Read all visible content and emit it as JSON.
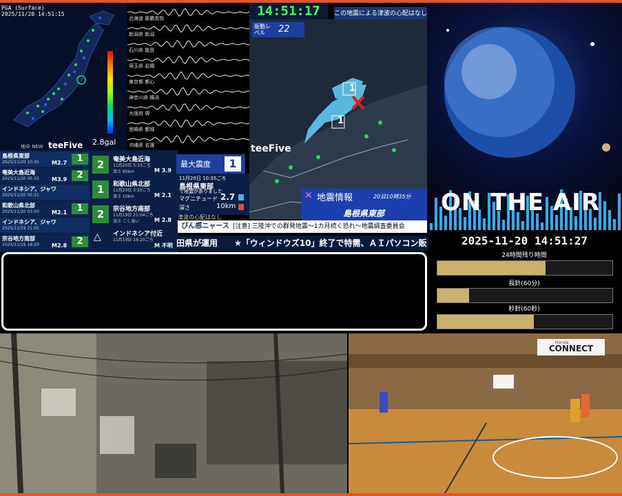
{
  "pga_panel": {
    "title_line1": "PGA (Surface)",
    "title_line2": "2025/11/20 14:51:15",
    "max_label": "2.8gal",
    "note": "地中 NEW",
    "brand": "teeFive"
  },
  "waveform": {
    "stations": [
      "北海道 那覇長牧",
      "新潟県 新潟",
      "石川県 能登",
      "埼玉県 岩槻",
      "東京都 都心",
      "神奈川県 横浜",
      "大阪府 堺",
      "宮崎県 都城",
      "沖縄県 名護"
    ]
  },
  "quake_list": [
    {
      "region": "島根県東部",
      "time": "2025/11/20 10:35",
      "mag": "M2.7",
      "intensity": "1"
    },
    {
      "region": "奄美大島近海",
      "time": "2025/11/20 05:33",
      "mag": "M3.9",
      "intensity": "2"
    },
    {
      "region": "インドネシア、ジャワ",
      "time": "2025/11/20 05:31",
      "mag": "",
      "intensity": ""
    },
    {
      "region": "和歌山県北部",
      "time": "2025/11/20 03:50",
      "mag": "M2.1",
      "intensity": "1"
    },
    {
      "region": "インドネシア、ジャワ",
      "time": "2025/11/19 21:05",
      "mag": "",
      "intensity": ""
    },
    {
      "region": "宗谷地方南部",
      "time": "2025/11/19 18:20",
      "mag": "M2.8",
      "intensity": "2"
    }
  ],
  "quake_detail": [
    {
      "region": "奄美大島近海",
      "date": "11月20日 5:33ごろ",
      "depth": "深さ 60km",
      "mag": "M 3.9",
      "intensity": "2"
    },
    {
      "region": "和歌山県北部",
      "date": "11月20日 3:50ごろ",
      "depth": "深さ 10km",
      "mag": "M 2.1",
      "intensity": "1"
    },
    {
      "region": "宗谷地方南部",
      "date": "11月19日 21:04ごろ",
      "depth": "深さ ごく浅い",
      "mag": "M 2.8",
      "intensity": "2"
    },
    {
      "region": "インドネシア付近",
      "date": "11月19日 18:20ごろ",
      "depth": "",
      "mag": "M 不明",
      "intensity": ""
    }
  ],
  "intensity_label": "最大震度",
  "max_intensity": {
    "label": "最大震度",
    "value": "1"
  },
  "epicenter": {
    "date": "11月20日 10:35ごろ",
    "region": "島根県東部",
    "note": "で地震がありました",
    "magnitude_label": "マグニチュード",
    "magnitude": "2.7",
    "depth_label": "深さ",
    "depth": "10km",
    "tsunami_note": "津波の心配はなし"
  },
  "map": {
    "clock": "14:51:17",
    "tsunami_banner": "この地震による津波の心配はなし",
    "level_label": "振動レベル",
    "level_value": "22",
    "info_title": "地震情報",
    "info_time": "20日10時35分",
    "info_region": "島根県東部",
    "brand": "teeFive"
  },
  "tickers": {
    "label": "びん感ニャース",
    "line1": "[注意] 三陸沖での群発地震〜1カ月続く恐れ〜地震調査委員会",
    "line2": "田県が運用　　★「ウィンドウズ10」終了で特需、ＡＩパソコン販"
  },
  "space": {
    "onair": "ON THE AIR",
    "datetime": "2025-11-20 14:51:27"
  },
  "timers": [
    {
      "label": "24時間残り時間",
      "fill": 0.62
    },
    {
      "label": "長針(60分)",
      "fill": 0.18
    },
    {
      "label": "秒針(60秒)",
      "fill": 0.55
    }
  ],
  "camera": {
    "connect_label": "CONNECT",
    "connect_small": "Honda"
  }
}
